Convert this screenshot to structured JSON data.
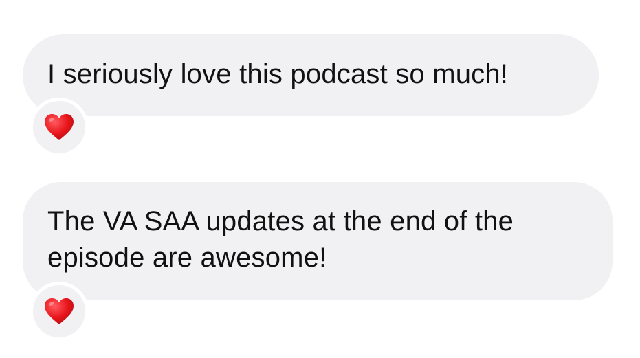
{
  "messages": [
    {
      "text": "I seriously love this podcast so much!",
      "reaction": {
        "icon": "heart-icon",
        "color": "#e8161c"
      }
    },
    {
      "text": "The VA SAA updates at the end of the episode are awesome!",
      "reaction": {
        "icon": "heart-icon",
        "color": "#e8161c"
      }
    }
  ],
  "colors": {
    "bubble_background": "#f1f1f3",
    "page_background": "#ffffff",
    "text": "#111111"
  }
}
